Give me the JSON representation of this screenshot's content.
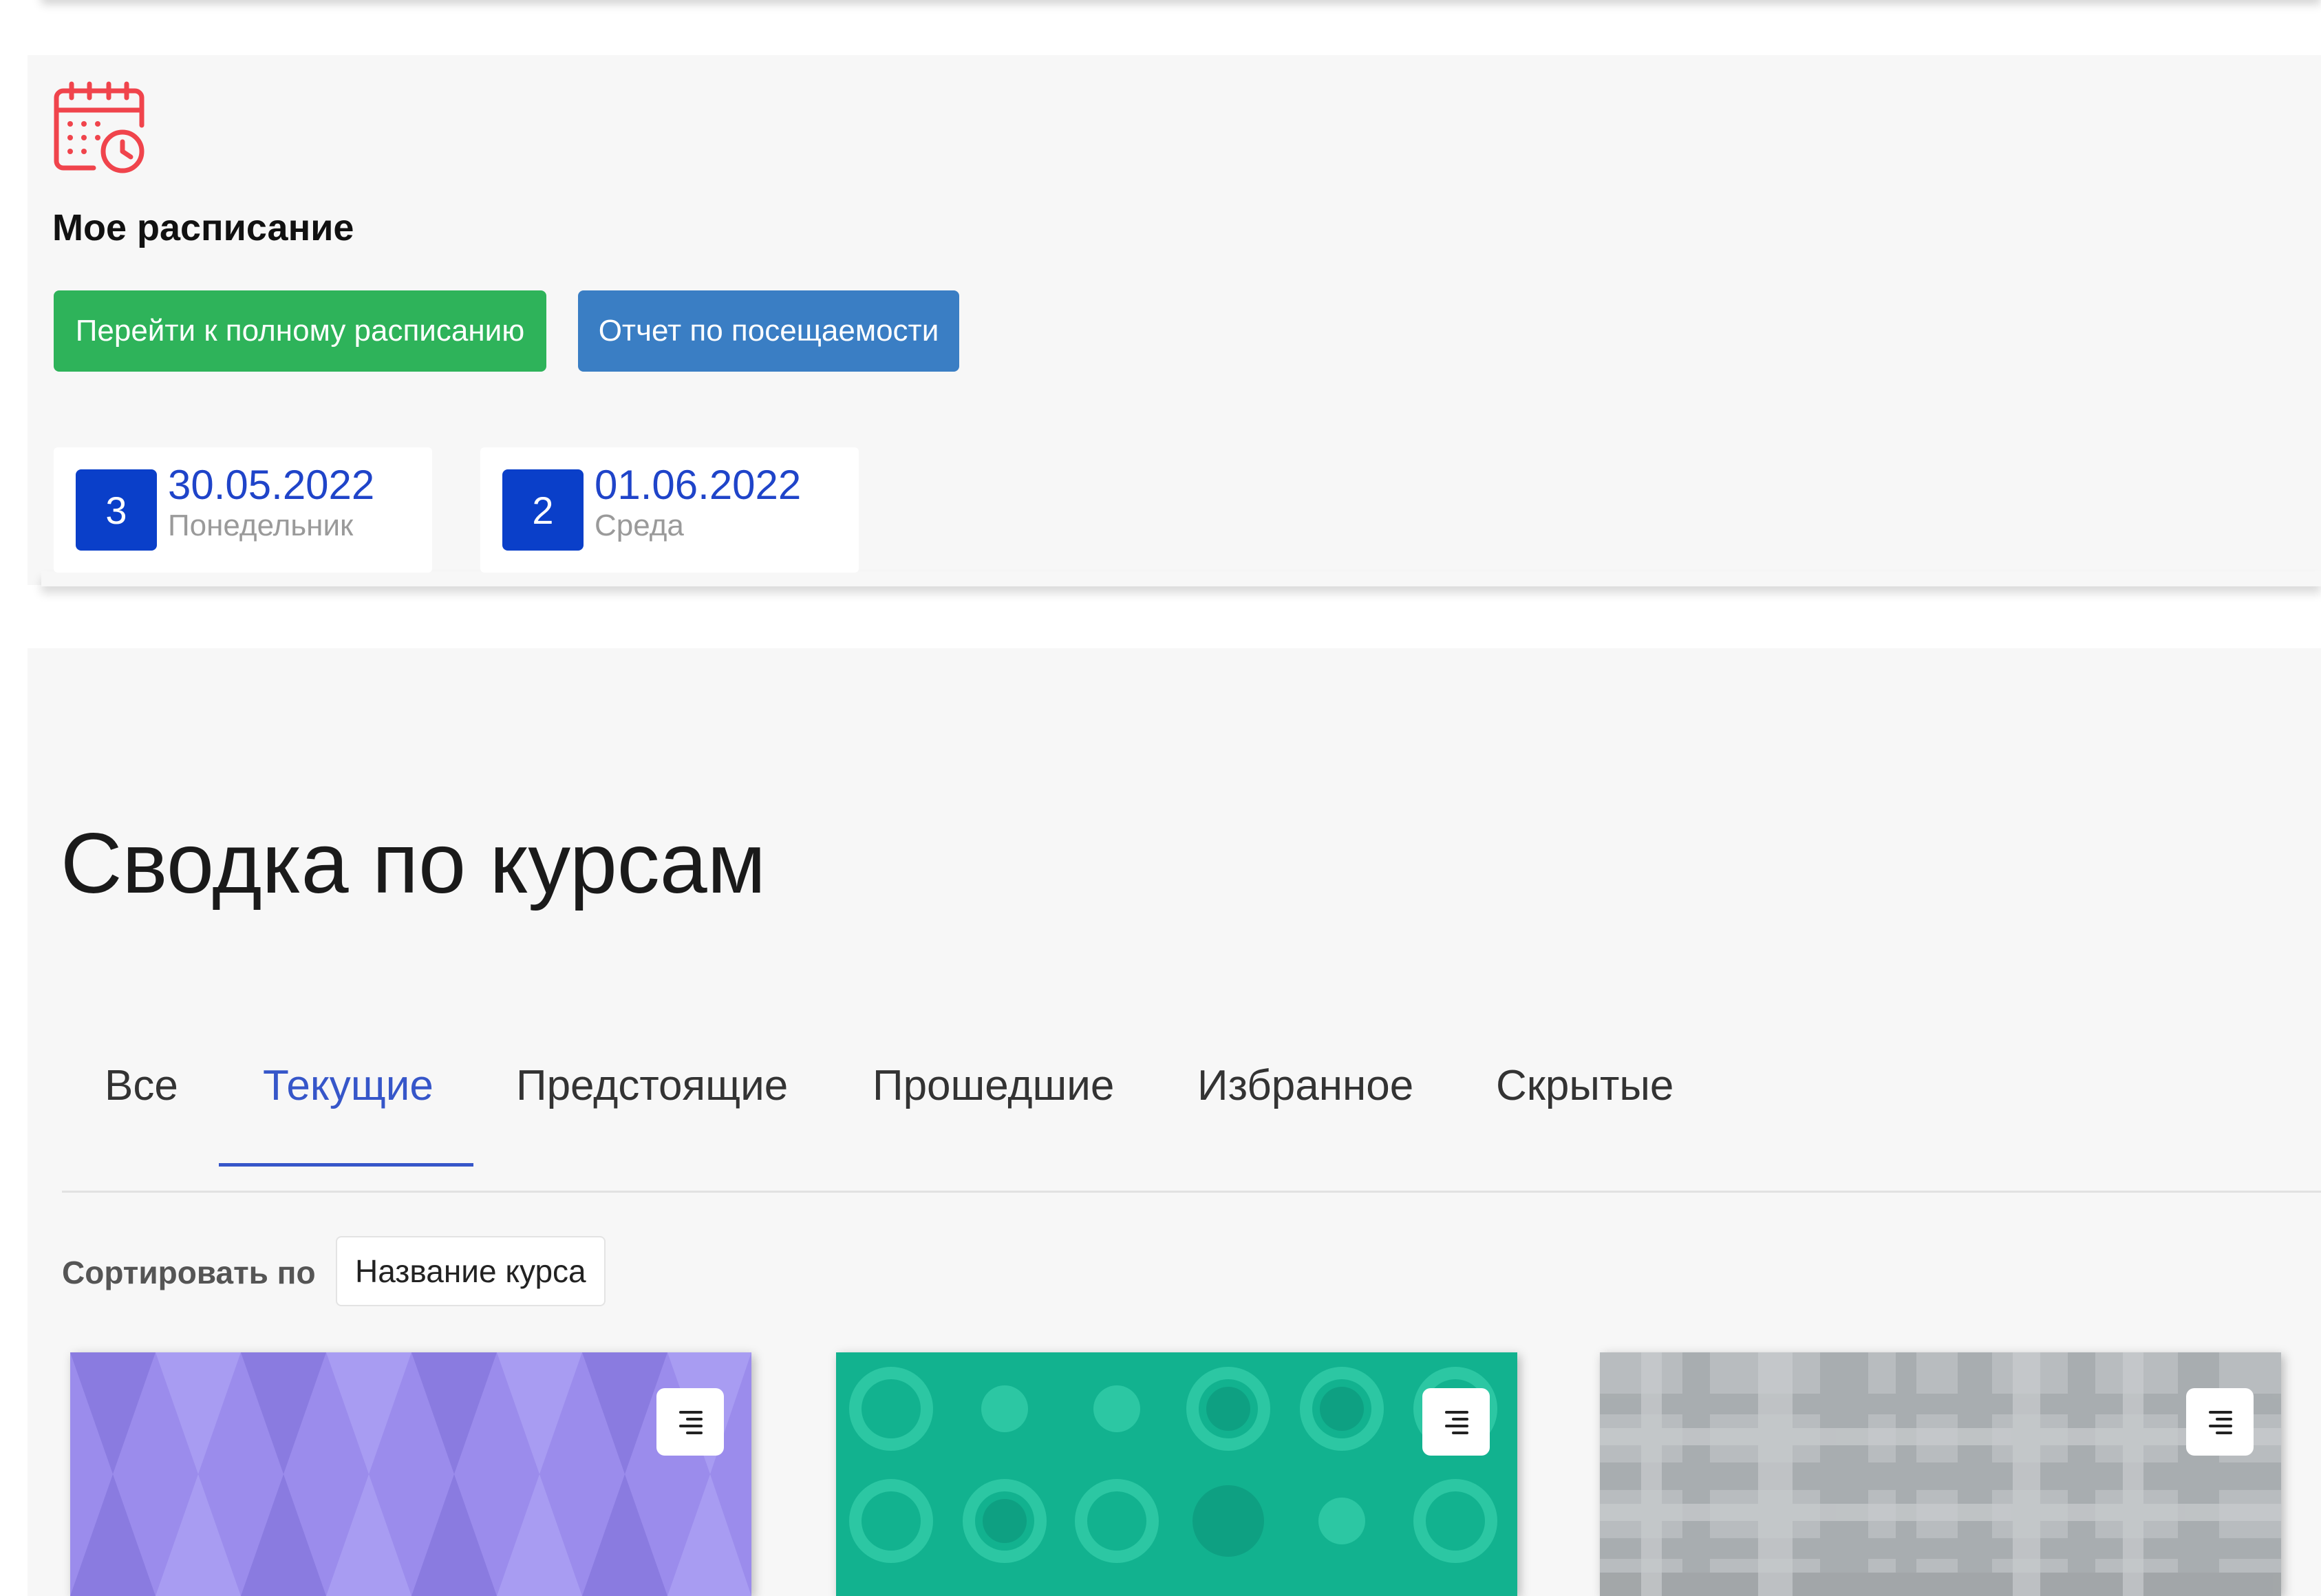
{
  "schedule": {
    "title": "Мое расписание",
    "icon": "calendar-clock-icon",
    "accent": "#f0444c",
    "buttons": {
      "full_schedule": "Перейти к полному расписанию",
      "attendance_report": "Отчет по посещаемости"
    },
    "days": [
      {
        "count": "3",
        "date": "30.05.2022",
        "weekday": "Понедельник"
      },
      {
        "count": "2",
        "date": "01.06.2022",
        "weekday": "Среда"
      }
    ]
  },
  "courses": {
    "title": "Сводка по курсам",
    "tabs": [
      {
        "label": "Все",
        "active": false
      },
      {
        "label": "Текущие",
        "active": true
      },
      {
        "label": "Предстоящие",
        "active": false
      },
      {
        "label": "Прошедшие",
        "active": false
      },
      {
        "label": "Избранное",
        "active": false
      },
      {
        "label": "Скрытые",
        "active": false
      }
    ],
    "sort": {
      "label": "Сортировать по",
      "value": "Название курса"
    },
    "cards": [
      {
        "pattern": "argyle",
        "color": "#9b8cec",
        "menu_icon": "menu-lines-icon"
      },
      {
        "pattern": "circles",
        "color": "#12b28f",
        "menu_icon": "menu-lines-icon"
      },
      {
        "pattern": "plaid",
        "color": "#b8bcbf",
        "menu_icon": "menu-lines-icon"
      }
    ]
  },
  "colors": {
    "green_button": "#2eb35a",
    "blue_button": "#3a7ec4",
    "day_badge": "#0a3fc9",
    "active_tab": "#3656c9"
  }
}
